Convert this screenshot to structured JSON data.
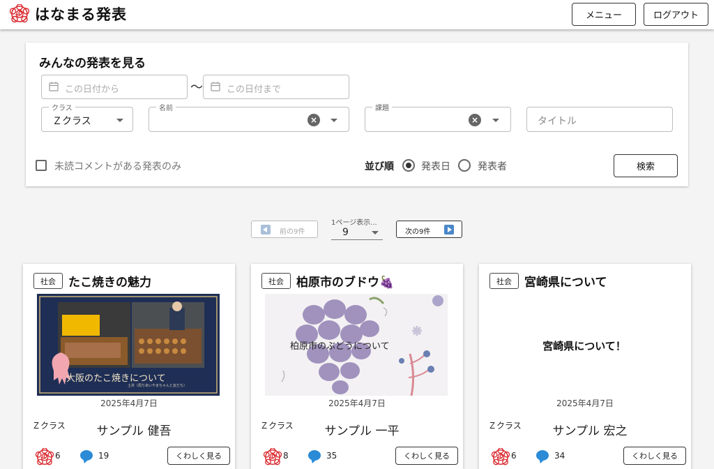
{
  "header": {
    "title": "はなまる発表",
    "menu_label": "メニュー",
    "logout_label": "ログアウト"
  },
  "filter": {
    "title": "みんなの発表を見る",
    "date_from_placeholder": "この日付から",
    "date_separator": "〜",
    "date_to_placeholder": "この日付まで",
    "class_label": "クラス",
    "class_value": "Ｚクラス",
    "name_label": "名前",
    "name_value": "",
    "subject_label": "課題",
    "subject_value": "",
    "title_placeholder": "タイトル",
    "unread_only_label": "未読コメントがある発表のみ",
    "unread_only_checked": false,
    "sort_label": "並び順",
    "sort_options": [
      "発表日",
      "発表者"
    ],
    "sort_selected": "発表日",
    "search_label": "検索"
  },
  "pagination": {
    "prev_label": "前の9件",
    "per_page_label": "1ページ表示...",
    "per_page_value": "9",
    "next_label": "次の9件"
  },
  "cards": [
    {
      "tag": "社会",
      "title": "たこ焼きの魅力",
      "thumb_caption": "大阪のたこ焼きについて",
      "thumb_subcaption": "土井（周りあいやまちゃんと友だち）",
      "date": "2025年4月7日",
      "class": "Ｚクラス",
      "author": "サンプル 健吾",
      "hanamaru_count": "6",
      "comment_count": "19",
      "detail_label": "くわしく見る"
    },
    {
      "tag": "社会",
      "title": "柏原市のブドウ🍇",
      "thumb_caption": "柏原市のぶどうについて",
      "date": "2025年4月7日",
      "class": "Ｚクラス",
      "author": "サンプル 一平",
      "hanamaru_count": "8",
      "comment_count": "35",
      "detail_label": "くわしく見る"
    },
    {
      "tag": "社会",
      "title": "宮崎県について",
      "thumb_caption": "宮崎県について！",
      "date": "2025年4月7日",
      "class": "Ｚクラス",
      "author": "サンプル 宏之",
      "hanamaru_count": "6",
      "comment_count": "34",
      "detail_label": "くわしく見る"
    }
  ],
  "colors": {
    "hanamaru_red": "#d9262c",
    "comment_blue": "#2b8bd6",
    "next_arrow": "#4a87c8"
  }
}
